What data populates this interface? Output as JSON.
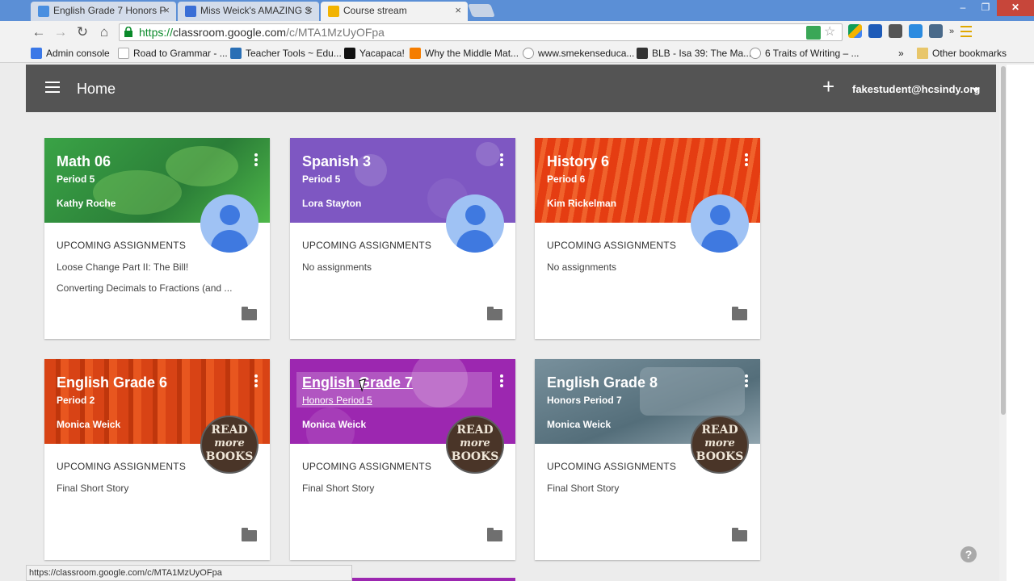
{
  "browser": {
    "tabs": [
      {
        "title": "English Grade 7 Honors P",
        "active": false
      },
      {
        "title": "Miss Weick's AMAZING S",
        "active": false
      },
      {
        "title": "Course stream",
        "active": true
      }
    ],
    "url_https": "https://",
    "url_host": "classroom.google.com",
    "url_path": "/c/MTA1MzUyOFpa",
    "bookmarks": [
      "Admin console",
      "Road to Grammar - ...",
      "Teacher Tools ~ Edu...",
      "Yacapaca!",
      "Why the Middle Mat...",
      "www.smekenseduca...",
      "BLB - Isa 39: The Ma...",
      "6 Traits of Writing – ...",
      "Other bookmarks"
    ],
    "bookmarks_overflow": "»",
    "status_url": "https://classroom.google.com/c/MTA1MzUyOFpa"
  },
  "appbar": {
    "title": "Home",
    "account": "fakestudent@hcsindy.org"
  },
  "section_label": "UPCOMING ASSIGNMENTS",
  "cards": [
    {
      "title": "Math 06",
      "period": "Period 5",
      "teacher": "Kathy Roche",
      "color": "#2e8b3a",
      "assignments": [
        "Loose Change Part II: The Bill!",
        "Converting Decimals to Fractions (and ..."
      ]
    },
    {
      "title": "Spanish 3",
      "period": "Period 5",
      "teacher": "Lora Stayton",
      "color": "#7e57c2",
      "assignments": [
        "No assignments"
      ]
    },
    {
      "title": "History 6",
      "period": "Period 6",
      "teacher": "Kim Rickelman",
      "color": "#e64a19",
      "assignments": [
        "No assignments"
      ]
    },
    {
      "title": "English Grade 6",
      "period": "Period 2",
      "teacher": "Monica Weick",
      "color": "#d84315",
      "assignments": [
        "Final Short Story"
      ]
    },
    {
      "title": "English Grade 7",
      "period": "Honors Period 5",
      "teacher": "Monica Weick",
      "color": "#9c27b0",
      "assignments": [
        "Final Short Story"
      ]
    },
    {
      "title": "English Grade 8",
      "period": "Honors Period 7",
      "teacher": "Monica Weick",
      "color": "#607d8b",
      "assignments": [
        "Final Short Story"
      ]
    }
  ],
  "books_avatar_text": [
    "READ",
    "more",
    "BOOKS"
  ],
  "help": "?"
}
